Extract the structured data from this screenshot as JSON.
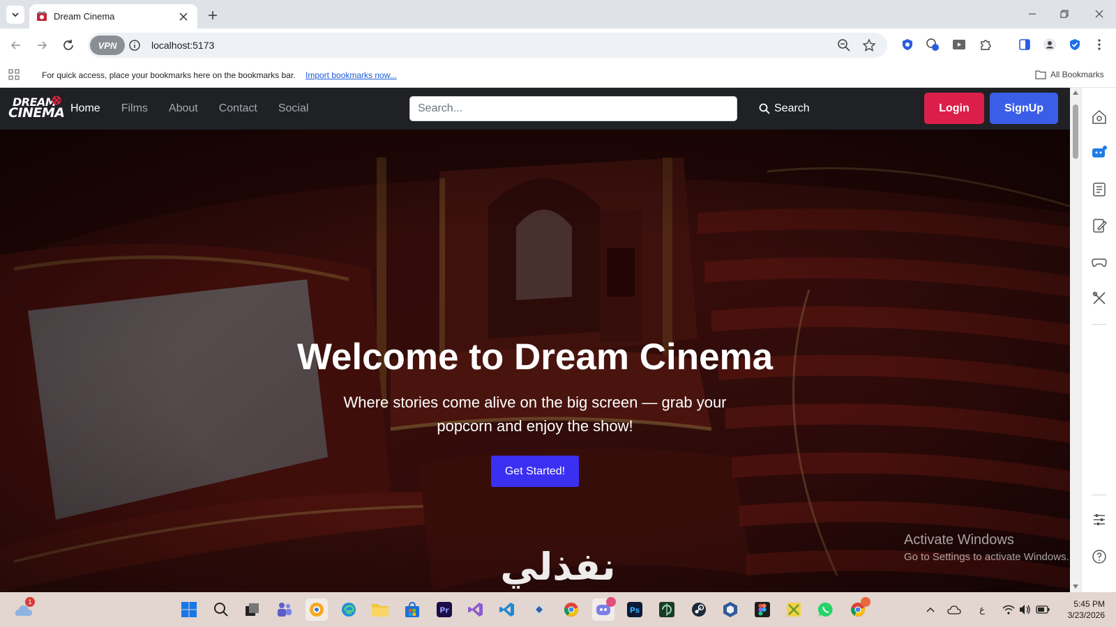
{
  "browser": {
    "tab_title": "Dream Cinema",
    "url": "localhost:5173",
    "vpn_label": "VPN",
    "bookmarks_bar": {
      "message": "For quick access, place your bookmarks here on the bookmarks bar.",
      "import_link": "Import bookmarks now...",
      "all_bookmarks": "All Bookmarks"
    }
  },
  "site": {
    "logo_line1": "DREAM",
    "logo_line2": "CINEMA",
    "nav": [
      "Home",
      "Films",
      "About",
      "Contact",
      "Social"
    ],
    "search_placeholder": "Search...",
    "search_button": "Search",
    "login_button": "Login",
    "signup_button": "SignUp",
    "hero": {
      "title": "Welcome to Dream Cinema",
      "subtitle": "Where stories come alive on the big screen — grab your popcorn and enjoy the show!",
      "cta": "Get Started!"
    },
    "watermark_text": "نفذلي"
  },
  "os": {
    "activate_title": "Activate Windows",
    "activate_sub": "Go to Settings to activate Windows.",
    "time": "5:45 PM",
    "date": "3/23/2026",
    "weather_badge": "1",
    "tray_lang": "ع",
    "taskbar_apps": [
      "start",
      "search",
      "task-view",
      "teams",
      "app-a",
      "edge",
      "file-explorer",
      "microsoft-store",
      "premiere-pro",
      "visual-studio",
      "vs-code",
      "app-b",
      "chrome",
      "discord",
      "photoshop",
      "app-c",
      "steam",
      "app-d",
      "figma",
      "app-e",
      "whatsapp",
      "chrome-profile"
    ]
  },
  "colors": {
    "navbar": "#1f2124",
    "login": "#dc1f4a",
    "signup": "#3b5ee8",
    "cta": "#3b2ff2",
    "hero_base": "#3a0e0e"
  }
}
